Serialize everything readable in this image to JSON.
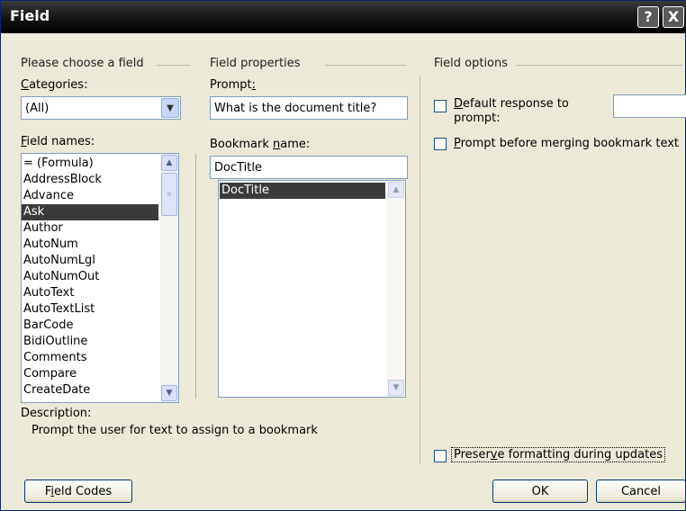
{
  "window": {
    "title": "Field",
    "help_glyph": "?",
    "close_glyph": "X"
  },
  "left": {
    "group_label": "Please choose a field",
    "categories_label_ul": "C",
    "categories_label_rest": "ategories:",
    "categories_value": "(All)",
    "field_names_label_ul": "F",
    "field_names_label_rest": "ield names:",
    "field_names": [
      "= (Formula)",
      "AddressBlock",
      "Advance",
      "Ask",
      "Author",
      "AutoNum",
      "AutoNumLgl",
      "AutoNumOut",
      "AutoText",
      "AutoTextList",
      "BarCode",
      "BidiOutline",
      "Comments",
      "Compare",
      "CreateDate"
    ],
    "selected_field": "Ask",
    "description_label": "Description:",
    "description_text": "Prompt the user for text to assign to a bookmark"
  },
  "middle": {
    "group_label": "Field properties",
    "prompt_label": "Prompt",
    "prompt_label_ul": ":",
    "prompt_value": "What is the document title?",
    "bookmark_label_pre": "Bookmark ",
    "bookmark_label_ul": "n",
    "bookmark_label_rest": "ame:",
    "bookmark_value": "DocTitle",
    "bookmark_list": [
      "DocTitle"
    ]
  },
  "right": {
    "group_label": "Field options",
    "default_response_ul": "D",
    "default_response_rest": "efault response to",
    "default_response_line2": "prompt:",
    "prompt_before_ul": "P",
    "prompt_before_rest": "rompt before merging bookmark text",
    "preserve_pre": "Preser",
    "preserve_ul": "v",
    "preserve_rest": "e formatting during updates"
  },
  "buttons": {
    "field_codes_pre": "F",
    "field_codes_ul": "i",
    "field_codes_rest": "eld Codes",
    "ok": "OK",
    "cancel": "Cancel"
  }
}
